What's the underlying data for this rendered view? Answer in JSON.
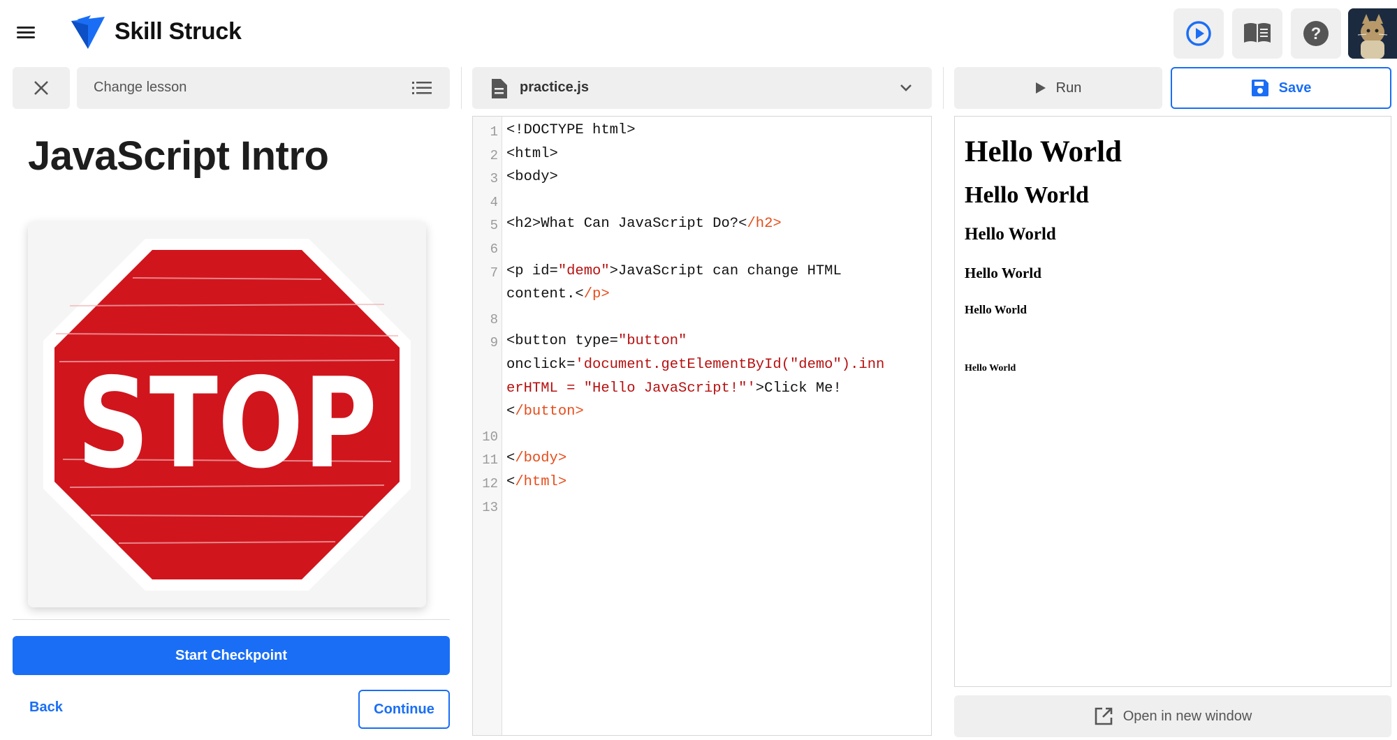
{
  "header": {
    "brand": "Skill Struck",
    "icons": [
      "menu-icon",
      "play-circle-icon",
      "book-icon",
      "help-icon",
      "avatar"
    ],
    "accent": "#1a6ef5"
  },
  "lesson": {
    "change_label": "Change lesson",
    "title": "JavaScript Intro",
    "image_text": "STOP",
    "start_checkpoint": "Start Checkpoint",
    "back": "Back",
    "continue": "Continue"
  },
  "editor": {
    "file": "practice.js",
    "lines": [
      [
        [
          "<!DOCTYPE html>",
          "p"
        ]
      ],
      [
        [
          "<html>",
          "p"
        ]
      ],
      [
        [
          "<body>",
          "p"
        ]
      ],
      [],
      [
        [
          "<h2>What Can JavaScript Do?<",
          "p"
        ],
        [
          "/h2>",
          "t"
        ]
      ],
      [],
      [
        [
          "<p id=",
          "p"
        ],
        [
          "\"demo\"",
          "s"
        ],
        [
          ">JavaScript can change HTML",
          "p"
        ]
      ],
      [
        [
          "content.<",
          "p"
        ],
        [
          "/p>",
          "t"
        ]
      ],
      [],
      [
        [
          "<button type=",
          "p"
        ],
        [
          "\"button\"",
          "s"
        ]
      ],
      [
        [
          "onclick=",
          "p"
        ],
        [
          "'document.getElementById(\"demo\").inn",
          "s"
        ]
      ],
      [
        [
          "erHTML = \"Hello JavaScript!\"'",
          "s"
        ],
        [
          ">Click Me!",
          "p"
        ]
      ],
      [
        [
          "<",
          "p"
        ],
        [
          "/button>",
          "t"
        ]
      ],
      [],
      [
        [
          "<",
          "p"
        ],
        [
          "/body>",
          "t"
        ]
      ],
      [
        [
          "<",
          "p"
        ],
        [
          "/html>",
          "t"
        ]
      ],
      []
    ],
    "line_numbers": [
      "1",
      "2",
      "3",
      "4",
      "5",
      "6",
      "7",
      "",
      "8",
      "9",
      "",
      "",
      "",
      "10",
      "11",
      "12",
      "13"
    ]
  },
  "preview": {
    "run": "Run",
    "save": "Save",
    "headings": [
      "Hello World",
      "Hello World",
      "Hello World",
      "Hello World",
      "Hello World",
      "Hello World"
    ],
    "open_new": "Open in new window"
  }
}
